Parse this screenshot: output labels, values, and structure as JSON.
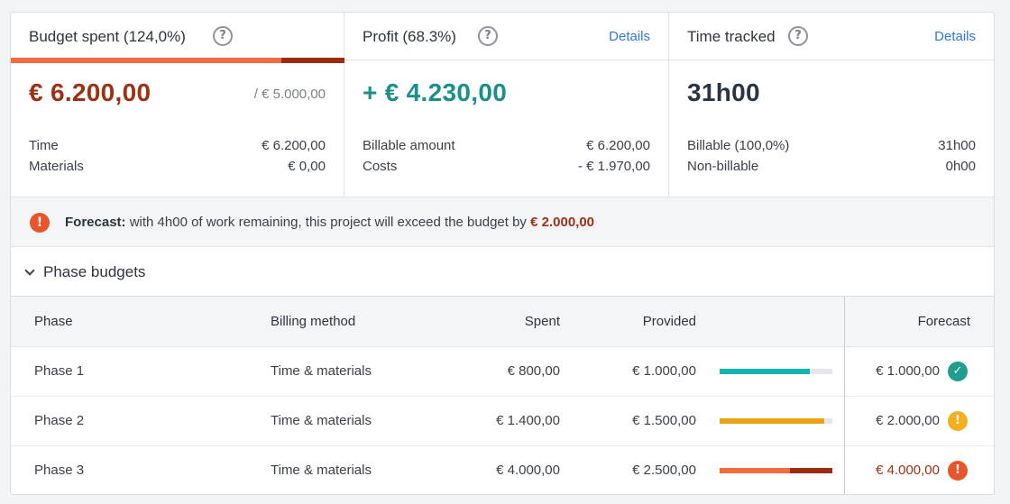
{
  "colors": {
    "accent_red": "#a03014",
    "accent_orange": "#f26c3f",
    "teal": "#1b8f8a",
    "bar_teal": "#12b5b0",
    "bar_yellow": "#e8a316",
    "link": "#2f78d8"
  },
  "budget": {
    "title": "Budget spent (124,0%)",
    "help_icon": "?",
    "value": "€ 6.200,00",
    "cap": "/ € 5.000,00",
    "rows": [
      {
        "label": "Time",
        "value": "€ 6.200,00"
      },
      {
        "label": "Materials",
        "value": "€ 0,00"
      }
    ]
  },
  "profit": {
    "title": "Profit (68.3%)",
    "help_icon": "?",
    "link": "Details",
    "value": "+ € 4.230,00",
    "rows": [
      {
        "label": "Billable amount",
        "value": "€ 6.200,00"
      },
      {
        "label": "Costs",
        "value": "- € 1.970,00"
      }
    ]
  },
  "time": {
    "title": "Time tracked",
    "help_icon": "?",
    "link": "Details",
    "value": "31h00",
    "rows": [
      {
        "label": "Billable (100,0%)",
        "value": "31h00"
      },
      {
        "label": "Non-billable",
        "value": "0h00"
      }
    ]
  },
  "forecast": {
    "icon": "!",
    "label": "Forecast:",
    "text": " with 4h00 of work remaining, this project will exceed the budget by ",
    "amount": "€ 2.000,00"
  },
  "phases": {
    "title": "Phase budgets",
    "columns": {
      "phase": "Phase",
      "billing": "Billing method",
      "spent": "Spent",
      "provided": "Provided",
      "forecast": "Forecast"
    },
    "rows": [
      {
        "phase": "Phase 1",
        "billing": "Time & materials",
        "spent": "€ 800,00",
        "provided": "€ 1.000,00",
        "progress": 0.8,
        "forecast": "€ 1.000,00",
        "status": "check-icon",
        "status_glyph": "✓"
      },
      {
        "phase": "Phase 2",
        "billing": "Time & materials",
        "spent": "€ 1.400,00",
        "provided": "€ 1.500,00",
        "progress": 0.93,
        "forecast": "€ 2.000,00",
        "status": "warning-icon",
        "status_glyph": "!"
      },
      {
        "phase": "Phase 3",
        "billing": "Time & materials",
        "spent": "€ 4.000,00",
        "provided": "€ 2.500,00",
        "progress": 1.6,
        "forecast": "€ 4.000,00",
        "status": "alert-icon",
        "status_glyph": "!"
      }
    ]
  }
}
